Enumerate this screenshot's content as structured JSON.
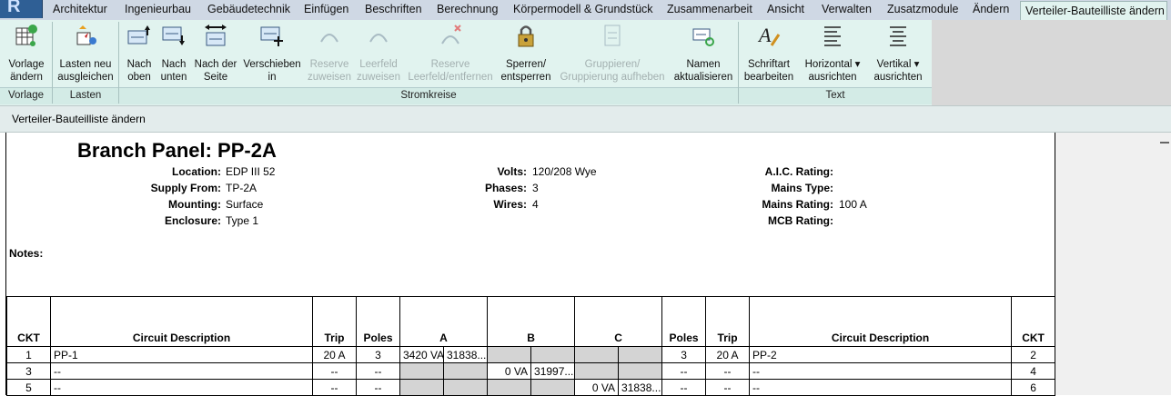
{
  "ribbon_tabs": [
    "Architektur",
    "Ingenieurbau",
    "Gebäudetechnik",
    "Einfügen",
    "Beschriften",
    "Berechnung",
    "Körpermodell & Grundstück",
    "Zusammenarbeit",
    "Ansicht",
    "Verwalten",
    "Zusatzmodule",
    "Ändern",
    "Verteiler-Bauteilliste ändern"
  ],
  "ribbon": {
    "vorlage": {
      "line1": "Vorlage",
      "line2": "ändern"
    },
    "lasten": {
      "line1": "Lasten neu",
      "line2": "ausgleichen"
    },
    "nach_oben": {
      "line1": "Nach",
      "line2": "oben"
    },
    "nach_unten": {
      "line1": "Nach",
      "line2": "unten"
    },
    "nach_seite": {
      "line1": "Nach der",
      "line2": "Seite"
    },
    "verschieben": {
      "line1": "Verschieben",
      "line2": "in"
    },
    "reserve_zuweisen": {
      "line1": "Reserve",
      "line2": "zuweisen"
    },
    "leerfeld": {
      "line1": "Leerfeld",
      "line2": "zuweisen"
    },
    "reserve_entfernen": {
      "line1": "Reserve",
      "line2": "Leerfeld/entfernen"
    },
    "sperren": {
      "line1": "Sperren/",
      "line2": "entsperren"
    },
    "gruppieren": {
      "line1": "Gruppieren/",
      "line2": "Gruppierung aufheben"
    },
    "namen": {
      "line1": "Namen",
      "line2": "aktualisieren"
    },
    "schriftart": {
      "line1": "Schriftart",
      "line2": "bearbeiten"
    },
    "horizontal": {
      "line1": "Horizontal",
      "line2": "ausrichten"
    },
    "vertikal": {
      "line1": "Vertikal",
      "line2": "ausrichten"
    },
    "groups": {
      "vorlage": "Vorlage",
      "lasten": "Lasten",
      "stromkreise": "Stromkreise",
      "text": "Text"
    }
  },
  "context_bar": "Verteiler-Bauteilliste ändern",
  "panel": {
    "title": "Branch Panel: PP-2A",
    "location_label": "Location:",
    "location": "EDP III 52",
    "supply_label": "Supply From:",
    "supply": "TP-2A",
    "mounting_label": "Mounting:",
    "mounting": "Surface",
    "enclosure_label": "Enclosure:",
    "enclosure": "Type 1",
    "volts_label": "Volts:",
    "volts": "120/208 Wye",
    "phases_label": "Phases:",
    "phases": "3",
    "wires_label": "Wires:",
    "wires": "4",
    "aic_label": "A.I.C. Rating:",
    "aic": "",
    "mains_type_label": "Mains Type:",
    "mains_type": "",
    "mains_rating_label": "Mains Rating:",
    "mains_rating": "100 A",
    "mcb_label": "MCB Rating:",
    "mcb": "",
    "notes_label": "Notes:"
  },
  "schedule": {
    "headers": [
      "CKT",
      "Circuit Description",
      "Trip",
      "Poles",
      "A",
      "B",
      "C",
      "Poles",
      "Trip",
      "Circuit Description",
      "CKT"
    ],
    "rows": [
      {
        "ckt_l": "1",
        "desc_l": "PP-1",
        "trip_l": "20 A",
        "poles_l": "3",
        "a1": "3420 VA",
        "a2": "31838...",
        "b1": "",
        "b2": "",
        "c1": "",
        "c2": "",
        "poles_r": "3",
        "trip_r": "20 A",
        "desc_r": "PP-2",
        "ckt_r": "2"
      },
      {
        "ckt_l": "3",
        "desc_l": "--",
        "trip_l": "--",
        "poles_l": "--",
        "a1": "",
        "a2": "",
        "b1": "0 VA",
        "b2": "31997...",
        "c1": "",
        "c2": "",
        "poles_r": "--",
        "trip_r": "--",
        "desc_r": "--",
        "ckt_r": "4"
      },
      {
        "ckt_l": "5",
        "desc_l": "--",
        "trip_l": "--",
        "poles_l": "--",
        "a1": "",
        "a2": "",
        "b1": "",
        "b2": "",
        "c1": "0 VA",
        "c2": "31838...",
        "poles_r": "--",
        "trip_r": "--",
        "desc_r": "--",
        "ckt_r": "6"
      }
    ]
  },
  "colors": {
    "ribbon_bg": "#e1f3ef",
    "tabbar_bg": "#cfd8e4",
    "accent": "#2f5f95",
    "disabled_text": "#a3b0b0",
    "cell_shade": "#d4d4d4"
  }
}
